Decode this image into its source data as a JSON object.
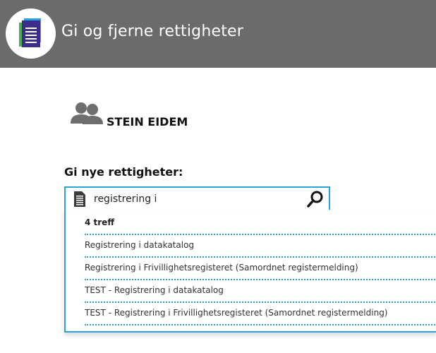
{
  "header": {
    "title": "Gi og fjerne rettigheter",
    "logo_icon": "document-stack-icon",
    "background": "#6b6b6b"
  },
  "user": {
    "icon": "users-icon",
    "name": "STEIN EIDEM"
  },
  "grant": {
    "label": "Gi nye rettigheter:",
    "search": {
      "value": "registrering i",
      "placeholder": "",
      "left_icon": "document-icon",
      "right_icon": "search-icon"
    },
    "results": {
      "count_label": "4 treff",
      "items": [
        "Registrering i datakatalog",
        "Registrering i Frivillighetsregisteret (Samordnet registermelding)",
        "TEST - Registrering i datakatalog",
        "TEST - Registrering i Frivillighetsregisteret (Samordnet registermelding)"
      ]
    }
  },
  "colors": {
    "accent": "#2aa3e4",
    "header": "#6b6b6b"
  }
}
